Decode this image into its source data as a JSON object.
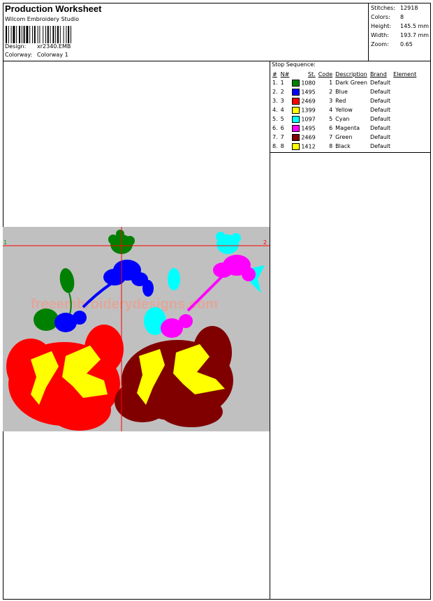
{
  "header": {
    "title": "Production Worksheet",
    "vendor": "Wilcom  Embroidery Studio",
    "design_label": "Design:",
    "design_value": "xr2340.EMB",
    "colorway_label": "Colorway:",
    "colorway_value": "Colorway 1"
  },
  "stats": [
    {
      "label": "Stitches:",
      "value": "12918"
    },
    {
      "label": "Colors:",
      "value": "8"
    },
    {
      "label": "Height:",
      "value": "145.5 mm"
    },
    {
      "label": "Width:",
      "value": "193.7 mm"
    },
    {
      "label": "Zoom:",
      "value": "0.65"
    }
  ],
  "stop_sequence": {
    "title": "Stop Sequence:",
    "headers": [
      "#",
      "N#",
      "St.",
      "Code",
      "Description",
      "Brand",
      "Element"
    ],
    "rows": [
      {
        "num": "1.",
        "n": "1",
        "color": "#008000",
        "st": "1080",
        "code": "1",
        "desc": "Dark Green",
        "brand": "Default"
      },
      {
        "num": "2.",
        "n": "2",
        "color": "#0000FF",
        "st": "1495",
        "code": "2",
        "desc": "Blue",
        "brand": "Default"
      },
      {
        "num": "3.",
        "n": "3",
        "color": "#FF0000",
        "st": "2469",
        "code": "3",
        "desc": "Red",
        "brand": "Default"
      },
      {
        "num": "4.",
        "n": "4",
        "color": "#FFFF00",
        "st": "1399",
        "code": "4",
        "desc": "Yellow",
        "brand": "Default"
      },
      {
        "num": "5.",
        "n": "5",
        "color": "#00FFFF",
        "st": "1097",
        "code": "5",
        "desc": "Cyan",
        "brand": "Default"
      },
      {
        "num": "6.",
        "n": "6",
        "color": "#FF00FF",
        "st": "1495",
        "code": "6",
        "desc": "Magenta",
        "brand": "Default"
      },
      {
        "num": "7.",
        "n": "7",
        "color": "#800000",
        "st": "2469",
        "code": "7",
        "desc": "Green",
        "brand": "Default"
      },
      {
        "num": "8.",
        "n": "8",
        "color": "#FFFF00",
        "st": "1412",
        "code": "8",
        "desc": "Black",
        "brand": "Default"
      }
    ]
  },
  "design": {
    "start_marker": "1",
    "end_marker": "2",
    "watermark": "freeembroiderydesigns.com"
  }
}
